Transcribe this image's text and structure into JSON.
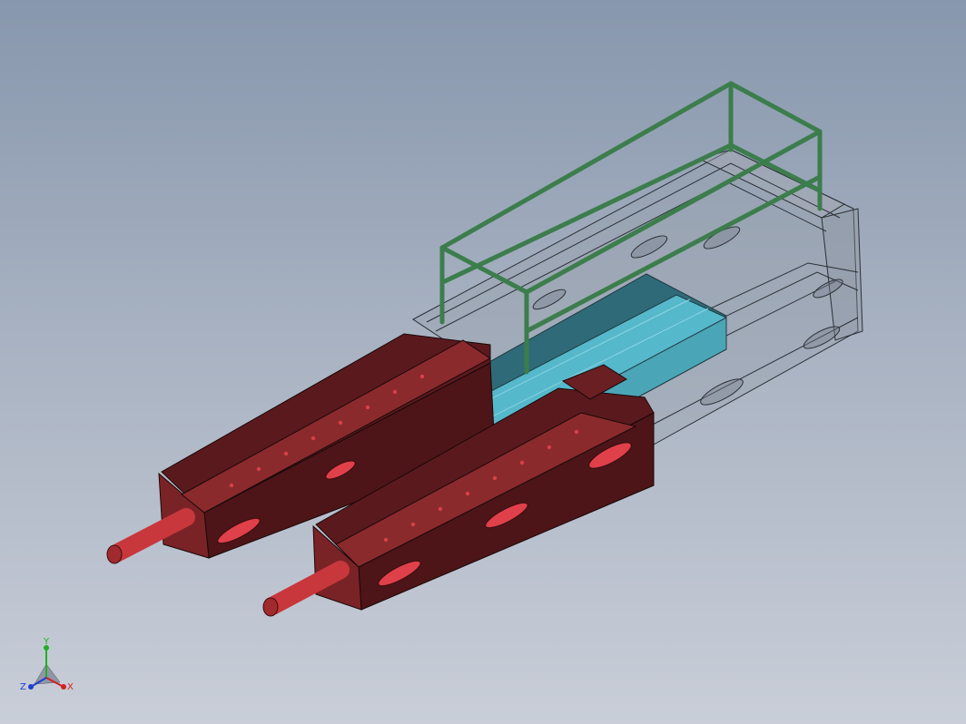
{
  "triad": {
    "x_label": "X",
    "y_label": "Y",
    "z_label": "Z"
  },
  "colors": {
    "background_top": "#8797ad",
    "background_bottom": "#c9ced8",
    "rail_red": "#7a2326",
    "rail_red_dark": "#4d1517",
    "slot_red": "#e0404a",
    "pin_red": "#c8373c",
    "carriage_cyan": "#55b8cb",
    "carriage_teal": "#2f6a78",
    "railing_green": "#3c7d4c",
    "frame_gray": "#8d96a3",
    "axis_x": "#d42020",
    "axis_y": "#20b020",
    "axis_z": "#2040d0"
  }
}
